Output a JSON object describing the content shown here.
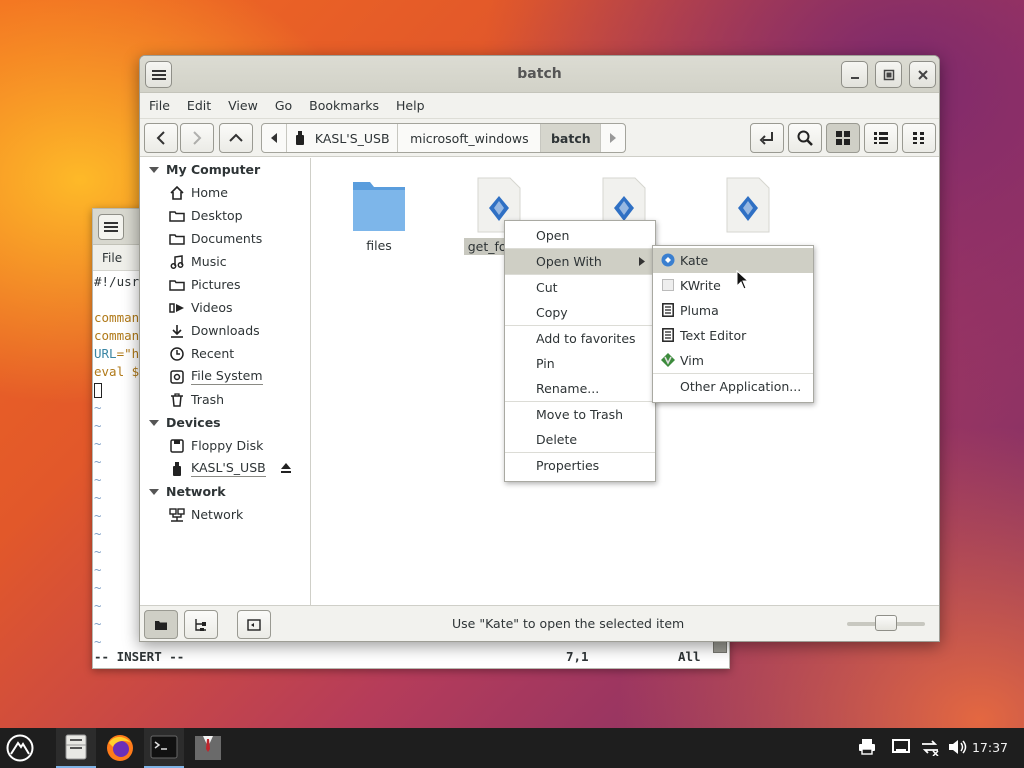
{
  "terminal": {
    "menu": [
      "File"
    ],
    "lines": [
      {
        "parts": [
          {
            "t": "#!/usr",
            "c": ""
          }
        ]
      },
      {
        "parts": [
          {
            "t": "",
            "c": ""
          }
        ]
      },
      {
        "parts": [
          {
            "t": "comman",
            "c": "kw"
          }
        ]
      },
      {
        "parts": [
          {
            "t": "comman",
            "c": "kw"
          }
        ]
      },
      {
        "parts": [
          {
            "t": "URL",
            "c": "var"
          },
          {
            "t": "=\"h",
            "c": "kw"
          }
        ]
      },
      {
        "parts": [
          {
            "t": "eval $",
            "c": "kw"
          }
        ]
      }
    ],
    "tilde": "~",
    "status_mode": "-- INSERT --",
    "status_pos": "7,1",
    "status_all": "All"
  },
  "file_manager": {
    "title": "batch",
    "menu": [
      "File",
      "Edit",
      "View",
      "Go",
      "Bookmarks",
      "Help"
    ],
    "path": [
      "KASL'S_USB",
      "microsoft_windows",
      "batch"
    ],
    "sidebar": {
      "my_computer": "My Computer",
      "places": [
        "Home",
        "Desktop",
        "Documents",
        "Music",
        "Pictures",
        "Videos",
        "Downloads",
        "Recent",
        "File System",
        "Trash"
      ],
      "devices_head": "Devices",
      "devices": [
        "Floppy Disk",
        "KASL'S_USB"
      ],
      "network_head": "Network",
      "network": [
        "Network"
      ]
    },
    "files": [
      {
        "name": "files",
        "type": "folder"
      },
      {
        "name": "get_forkid",
        "type": "script",
        "selected": true
      },
      {
        "name": "",
        "type": "script"
      },
      {
        "name": "",
        "type": "script"
      }
    ],
    "status_text": "Use \"Kate\" to open the selected item",
    "zoom_level": 0.5
  },
  "context_menu": {
    "items": [
      "Open",
      "Open With",
      "Cut",
      "Copy",
      "Add to favorites",
      "Pin",
      "Rename...",
      "Move to Trash",
      "Delete",
      "Properties"
    ]
  },
  "open_with_menu": {
    "items": [
      "Kate",
      "KWrite",
      "Pluma",
      "Text Editor",
      "Vim",
      "Other Application..."
    ]
  },
  "taskbar": {
    "clock": "17:37"
  }
}
